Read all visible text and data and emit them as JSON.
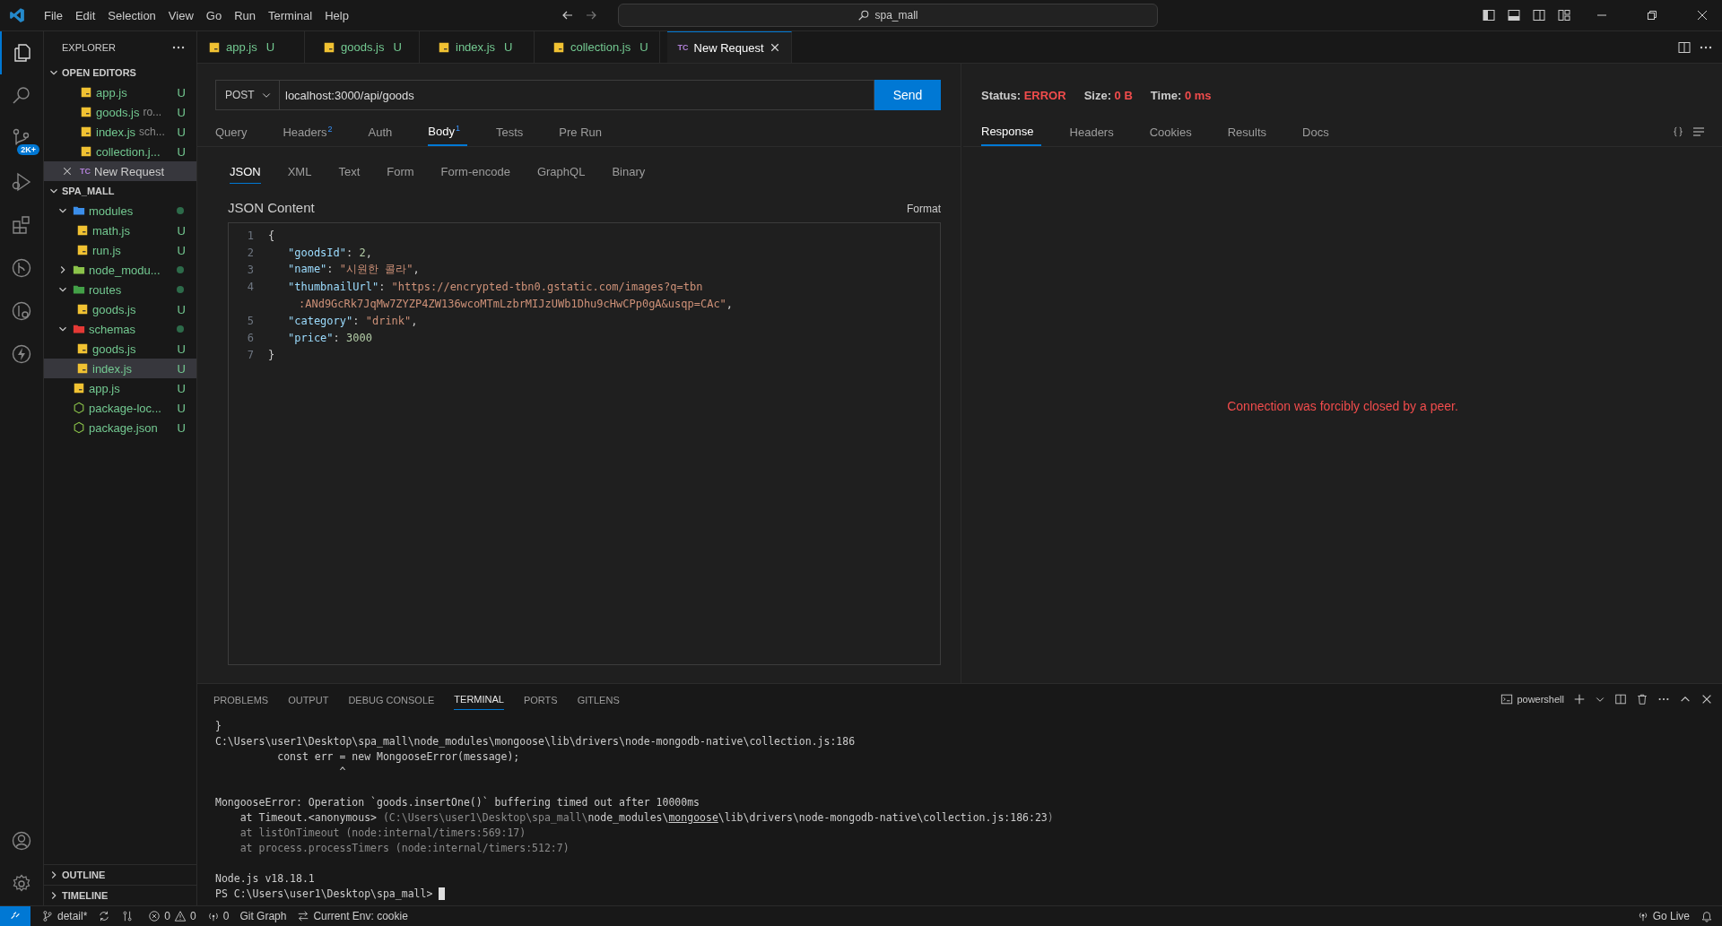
{
  "title_bar": {
    "menu": [
      "File",
      "Edit",
      "Selection",
      "View",
      "Go",
      "Run",
      "Terminal",
      "Help"
    ],
    "search": "spa_mall"
  },
  "activity_bar": {
    "items": [
      {
        "kind": "explorer",
        "selected": true
      },
      {
        "kind": "search",
        "selected": false
      },
      {
        "kind": "scm",
        "selected": false,
        "badge": "2K+"
      },
      {
        "kind": "debug",
        "selected": false
      },
      {
        "kind": "extensions",
        "selected": false
      },
      {
        "kind": "gitgraph",
        "selected": false
      },
      {
        "kind": "gitlens",
        "selected": false
      },
      {
        "kind": "thunder",
        "selected": false
      }
    ],
    "bottom": [
      {
        "kind": "account"
      },
      {
        "kind": "settings"
      }
    ]
  },
  "sidebar": {
    "title": "EXPLORER",
    "open_editors": {
      "title": "OPEN EDITORS",
      "expanded": true,
      "items": [
        {
          "kind": "js",
          "name": "app.js",
          "status": "U",
          "selected": false
        },
        {
          "kind": "js",
          "name": "goods.js",
          "description": "ro...",
          "status": "U",
          "selected": false
        },
        {
          "kind": "js",
          "name": "index.js",
          "description": "sch...",
          "status": "U",
          "selected": false
        },
        {
          "kind": "js",
          "name": "collection.j...",
          "status": "U",
          "selected": false
        },
        {
          "kind": "request",
          "icon_text": "TC",
          "name": "New Request",
          "selected": true
        }
      ]
    },
    "folder": {
      "title": "SPA_MALL",
      "expanded": true,
      "items": [
        {
          "kind": "folder",
          "name": "modules",
          "color": "#3b8eea",
          "expanded": true,
          "selected": false,
          "children": [
            {
              "kind": "js",
              "name": "math.js",
              "status": "U",
              "selected": false
            },
            {
              "kind": "js",
              "name": "run.js",
              "status": "U",
              "selected": false
            }
          ]
        },
        {
          "kind": "folder",
          "name": "node_modu...",
          "color": "#8bc34a",
          "expanded": false,
          "selected": false
        },
        {
          "kind": "folder",
          "name": "routes",
          "color": "#43a047",
          "expanded": true,
          "selected": false,
          "children": [
            {
              "kind": "js",
              "name": "goods.js",
              "status": "U",
              "selected": false
            }
          ]
        },
        {
          "kind": "folder",
          "name": "schemas",
          "color": "#e53935",
          "expanded": true,
          "selected": false,
          "children": [
            {
              "kind": "js",
              "name": "goods.js",
              "status": "U",
              "selected": false
            },
            {
              "kind": "js",
              "name": "index.js",
              "status": "U",
              "selected": true
            }
          ]
        },
        {
          "kind": "js",
          "name": "app.js",
          "status": "U",
          "selected": false
        },
        {
          "kind": "json",
          "name": "package-loc...",
          "status": "U",
          "selected": false
        },
        {
          "kind": "json",
          "name": "package.json",
          "status": "U",
          "selected": false
        }
      ]
    },
    "sections": [
      {
        "title": "OUTLINE",
        "expanded": false
      },
      {
        "title": "TIMELINE",
        "expanded": false
      }
    ]
  },
  "editor_tabs": [
    {
      "kind": "js",
      "name": "app.js",
      "status": "U",
      "selected": false
    },
    {
      "kind": "js",
      "name": "goods.js",
      "status": "U",
      "selected": false
    },
    {
      "kind": "js",
      "name": "index.js",
      "status": "U",
      "selected": false
    },
    {
      "kind": "js",
      "name": "collection.js",
      "status": "U",
      "selected": false
    },
    {
      "kind": "request",
      "icon_text": "TC",
      "name": "New Request",
      "selected": true
    }
  ],
  "request": {
    "method": "POST",
    "url": "localhost:3000/api/goods",
    "send": "Send",
    "tabs": [
      {
        "label": "Query",
        "selected": false
      },
      {
        "label": "Headers",
        "count": "2",
        "selected": false
      },
      {
        "label": "Auth",
        "selected": false
      },
      {
        "label": "Body",
        "count": "1",
        "selected": true
      },
      {
        "label": "Tests",
        "selected": false
      },
      {
        "label": "Pre Run",
        "selected": false
      }
    ],
    "body_tabs": [
      {
        "label": "JSON",
        "selected": true
      },
      {
        "label": "XML",
        "selected": false
      },
      {
        "label": "Text",
        "selected": false
      },
      {
        "label": "Form",
        "selected": false
      },
      {
        "label": "Form-encode",
        "selected": false
      },
      {
        "label": "GraphQL",
        "selected": false
      },
      {
        "label": "Binary",
        "selected": false
      }
    ],
    "content_label": "JSON Content",
    "format": "Format",
    "code": [
      {
        "number": "1",
        "kind": "brace",
        "text": "{"
      },
      {
        "number": "2",
        "kind": "number_pair",
        "key": "\"goodsId\"",
        "sep": ": ",
        "value": "2",
        "end": ","
      },
      {
        "number": "3",
        "kind": "string_pair",
        "key": "\"name\"",
        "sep": ": ",
        "value": "\"시원한 콜라\"",
        "end": ","
      },
      {
        "number": "4",
        "kind": "string_pair",
        "key": "\"thumbnailUrl\"",
        "sep": ": ",
        "value": "\"https://encrypted-tbn0.gstatic.com/images?q=tbn"
      },
      {
        "kind": "continuation",
        "value": ":ANd9GcRk7JqMw7ZYZP4ZW136wcoMTmLzbrMIJzUWb1Dhu9cHwCPp0gA&usqp=CAc\"",
        "end": ","
      },
      {
        "number": "5",
        "kind": "string_pair",
        "key": "\"category\"",
        "sep": ": ",
        "value": "\"drink\"",
        "end": ","
      },
      {
        "number": "6",
        "kind": "number_pair",
        "key": "\"price\"",
        "sep": ": ",
        "value": "3000"
      },
      {
        "number": "7",
        "kind": "brace",
        "text": "}"
      }
    ]
  },
  "response": {
    "status": [
      {
        "label": "Status:",
        "value": "ERROR"
      },
      {
        "label": "Size:",
        "value": "0 B"
      },
      {
        "label": "Time:",
        "value": "0 ms"
      }
    ],
    "tabs": [
      {
        "label": "Response",
        "selected": true
      },
      {
        "label": "Headers",
        "selected": false
      },
      {
        "label": "Cookies",
        "selected": false
      },
      {
        "label": "Results",
        "selected": false
      },
      {
        "label": "Docs",
        "selected": false
      }
    ],
    "message": "Connection was forcibly closed by a peer."
  },
  "panel": {
    "tabs": [
      {
        "label": "PROBLEMS",
        "selected": false
      },
      {
        "label": "OUTPUT",
        "selected": false
      },
      {
        "label": "DEBUG CONSOLE",
        "selected": false
      },
      {
        "label": "TERMINAL",
        "selected": true
      },
      {
        "label": "PORTS",
        "selected": false
      },
      {
        "label": "GITLENS",
        "selected": false
      }
    ],
    "shell": "powershell",
    "lines": [
      {
        "kind": "text",
        "segments": [
          {
            "text": "}",
            "kind": "plain"
          }
        ]
      },
      {
        "kind": "text",
        "segments": [
          {
            "text": "C:\\Users\\user1\\Desktop\\spa_mall\\node_modules\\mongoose\\lib\\drivers\\node-mongodb-native\\collection.js:186",
            "kind": "plain"
          }
        ]
      },
      {
        "kind": "text",
        "segments": [
          {
            "text": "          const err = new MongooseError(message);",
            "kind": "plain"
          }
        ]
      },
      {
        "kind": "text",
        "segments": [
          {
            "text": "                    ^",
            "kind": "plain"
          }
        ]
      },
      {
        "kind": "blank"
      },
      {
        "kind": "text",
        "segments": [
          {
            "text": "MongooseError: Operation `goods.insertOne()` buffering timed out after 10000ms",
            "kind": "plain"
          }
        ]
      },
      {
        "kind": "text",
        "segments": [
          {
            "text": "    at Timeout.<anonymous> ",
            "kind": "plain"
          },
          {
            "text": "(C:\\Users\\user1\\Desktop\\spa_mall\\",
            "kind": "dim"
          },
          {
            "text": "node_modules\\",
            "kind": "plain"
          },
          {
            "text": "mongoose",
            "kind": "link"
          },
          {
            "text": "\\lib\\drivers\\node-mongodb-native\\collection.js:186:23",
            "kind": "plain"
          },
          {
            "text": ")",
            "kind": "dim"
          }
        ]
      },
      {
        "kind": "text",
        "segments": [
          {
            "text": "    at listOnTimeout (node:internal/timers:569:17)",
            "kind": "dim"
          }
        ]
      },
      {
        "kind": "text",
        "segments": [
          {
            "text": "    at process.processTimers (node:internal/timers:512:7)",
            "kind": "dim"
          }
        ]
      },
      {
        "kind": "blank"
      },
      {
        "kind": "text",
        "segments": [
          {
            "text": "Node.js v18.18.1",
            "kind": "plain"
          }
        ]
      },
      {
        "kind": "prompt",
        "segments": [
          {
            "text": "PS C:\\Users\\user1\\Desktop\\spa_mall> ",
            "kind": "plain"
          }
        ]
      }
    ]
  },
  "status_bar": {
    "branch": "detail*",
    "errors": "0",
    "warnings": "0",
    "ports": "0",
    "git_graph": "Git Graph",
    "env": "Current Env: cookie",
    "go_live": "Go Live"
  }
}
